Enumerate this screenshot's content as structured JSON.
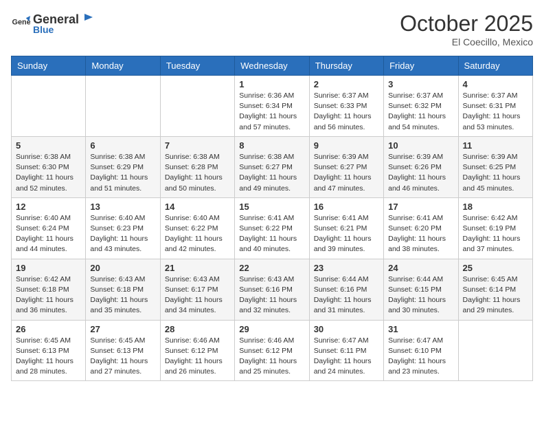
{
  "header": {
    "logo_general": "General",
    "logo_blue": "Blue",
    "month_title": "October 2025",
    "location": "El Coecillo, Mexico"
  },
  "days_of_week": [
    "Sunday",
    "Monday",
    "Tuesday",
    "Wednesday",
    "Thursday",
    "Friday",
    "Saturday"
  ],
  "weeks": [
    [
      {
        "day": "",
        "info": ""
      },
      {
        "day": "",
        "info": ""
      },
      {
        "day": "",
        "info": ""
      },
      {
        "day": "1",
        "info": "Sunrise: 6:36 AM\nSunset: 6:34 PM\nDaylight: 11 hours and 57 minutes."
      },
      {
        "day": "2",
        "info": "Sunrise: 6:37 AM\nSunset: 6:33 PM\nDaylight: 11 hours and 56 minutes."
      },
      {
        "day": "3",
        "info": "Sunrise: 6:37 AM\nSunset: 6:32 PM\nDaylight: 11 hours and 54 minutes."
      },
      {
        "day": "4",
        "info": "Sunrise: 6:37 AM\nSunset: 6:31 PM\nDaylight: 11 hours and 53 minutes."
      }
    ],
    [
      {
        "day": "5",
        "info": "Sunrise: 6:38 AM\nSunset: 6:30 PM\nDaylight: 11 hours and 52 minutes."
      },
      {
        "day": "6",
        "info": "Sunrise: 6:38 AM\nSunset: 6:29 PM\nDaylight: 11 hours and 51 minutes."
      },
      {
        "day": "7",
        "info": "Sunrise: 6:38 AM\nSunset: 6:28 PM\nDaylight: 11 hours and 50 minutes."
      },
      {
        "day": "8",
        "info": "Sunrise: 6:38 AM\nSunset: 6:27 PM\nDaylight: 11 hours and 49 minutes."
      },
      {
        "day": "9",
        "info": "Sunrise: 6:39 AM\nSunset: 6:27 PM\nDaylight: 11 hours and 47 minutes."
      },
      {
        "day": "10",
        "info": "Sunrise: 6:39 AM\nSunset: 6:26 PM\nDaylight: 11 hours and 46 minutes."
      },
      {
        "day": "11",
        "info": "Sunrise: 6:39 AM\nSunset: 6:25 PM\nDaylight: 11 hours and 45 minutes."
      }
    ],
    [
      {
        "day": "12",
        "info": "Sunrise: 6:40 AM\nSunset: 6:24 PM\nDaylight: 11 hours and 44 minutes."
      },
      {
        "day": "13",
        "info": "Sunrise: 6:40 AM\nSunset: 6:23 PM\nDaylight: 11 hours and 43 minutes."
      },
      {
        "day": "14",
        "info": "Sunrise: 6:40 AM\nSunset: 6:22 PM\nDaylight: 11 hours and 42 minutes."
      },
      {
        "day": "15",
        "info": "Sunrise: 6:41 AM\nSunset: 6:22 PM\nDaylight: 11 hours and 40 minutes."
      },
      {
        "day": "16",
        "info": "Sunrise: 6:41 AM\nSunset: 6:21 PM\nDaylight: 11 hours and 39 minutes."
      },
      {
        "day": "17",
        "info": "Sunrise: 6:41 AM\nSunset: 6:20 PM\nDaylight: 11 hours and 38 minutes."
      },
      {
        "day": "18",
        "info": "Sunrise: 6:42 AM\nSunset: 6:19 PM\nDaylight: 11 hours and 37 minutes."
      }
    ],
    [
      {
        "day": "19",
        "info": "Sunrise: 6:42 AM\nSunset: 6:18 PM\nDaylight: 11 hours and 36 minutes."
      },
      {
        "day": "20",
        "info": "Sunrise: 6:43 AM\nSunset: 6:18 PM\nDaylight: 11 hours and 35 minutes."
      },
      {
        "day": "21",
        "info": "Sunrise: 6:43 AM\nSunset: 6:17 PM\nDaylight: 11 hours and 34 minutes."
      },
      {
        "day": "22",
        "info": "Sunrise: 6:43 AM\nSunset: 6:16 PM\nDaylight: 11 hours and 32 minutes."
      },
      {
        "day": "23",
        "info": "Sunrise: 6:44 AM\nSunset: 6:16 PM\nDaylight: 11 hours and 31 minutes."
      },
      {
        "day": "24",
        "info": "Sunrise: 6:44 AM\nSunset: 6:15 PM\nDaylight: 11 hours and 30 minutes."
      },
      {
        "day": "25",
        "info": "Sunrise: 6:45 AM\nSunset: 6:14 PM\nDaylight: 11 hours and 29 minutes."
      }
    ],
    [
      {
        "day": "26",
        "info": "Sunrise: 6:45 AM\nSunset: 6:13 PM\nDaylight: 11 hours and 28 minutes."
      },
      {
        "day": "27",
        "info": "Sunrise: 6:45 AM\nSunset: 6:13 PM\nDaylight: 11 hours and 27 minutes."
      },
      {
        "day": "28",
        "info": "Sunrise: 6:46 AM\nSunset: 6:12 PM\nDaylight: 11 hours and 26 minutes."
      },
      {
        "day": "29",
        "info": "Sunrise: 6:46 AM\nSunset: 6:12 PM\nDaylight: 11 hours and 25 minutes."
      },
      {
        "day": "30",
        "info": "Sunrise: 6:47 AM\nSunset: 6:11 PM\nDaylight: 11 hours and 24 minutes."
      },
      {
        "day": "31",
        "info": "Sunrise: 6:47 AM\nSunset: 6:10 PM\nDaylight: 11 hours and 23 minutes."
      },
      {
        "day": "",
        "info": ""
      }
    ]
  ]
}
